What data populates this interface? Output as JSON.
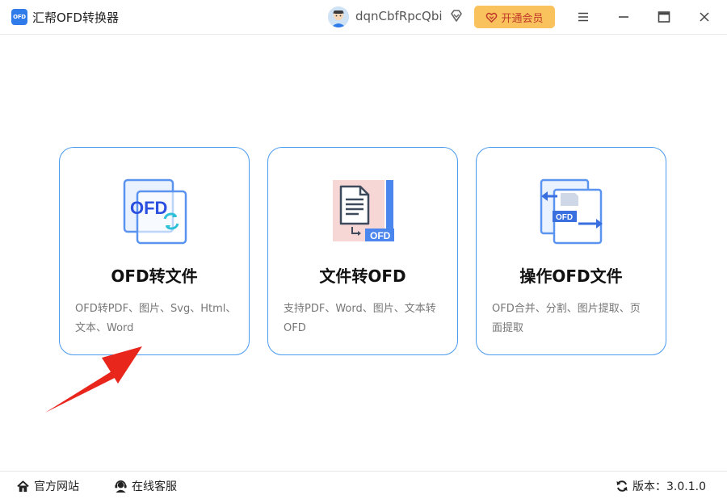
{
  "titlebar": {
    "logo_text": "OFD",
    "app_title": "汇帮OFD转换器",
    "username": "dqnCbfRpcQbi",
    "vip_label": "开通会员"
  },
  "cards": [
    {
      "title": "OFD转文件",
      "desc_line1": "OFD转PDF、图片、Svg、Html、",
      "desc_line2": "文本、Word",
      "icon_text": "OFD"
    },
    {
      "title": "文件转OFD",
      "desc_line1": "支持PDF、Word、图片、文本转",
      "desc_line2": "OFD",
      "icon_text": "OFD"
    },
    {
      "title": "操作OFD文件",
      "desc_line1": "OFD合并、分割、图片提取、页",
      "desc_line2": "面提取",
      "icon_text": "OFD"
    }
  ],
  "footer": {
    "website_label": "官方网站",
    "service_label": "在线客服",
    "version_label": "版本：3.0.1.0"
  },
  "colors": {
    "accent": "#4a9bef",
    "vip_bg": "#f9c25c",
    "vip_text": "#c0392b",
    "arrow": "#e8261c"
  }
}
